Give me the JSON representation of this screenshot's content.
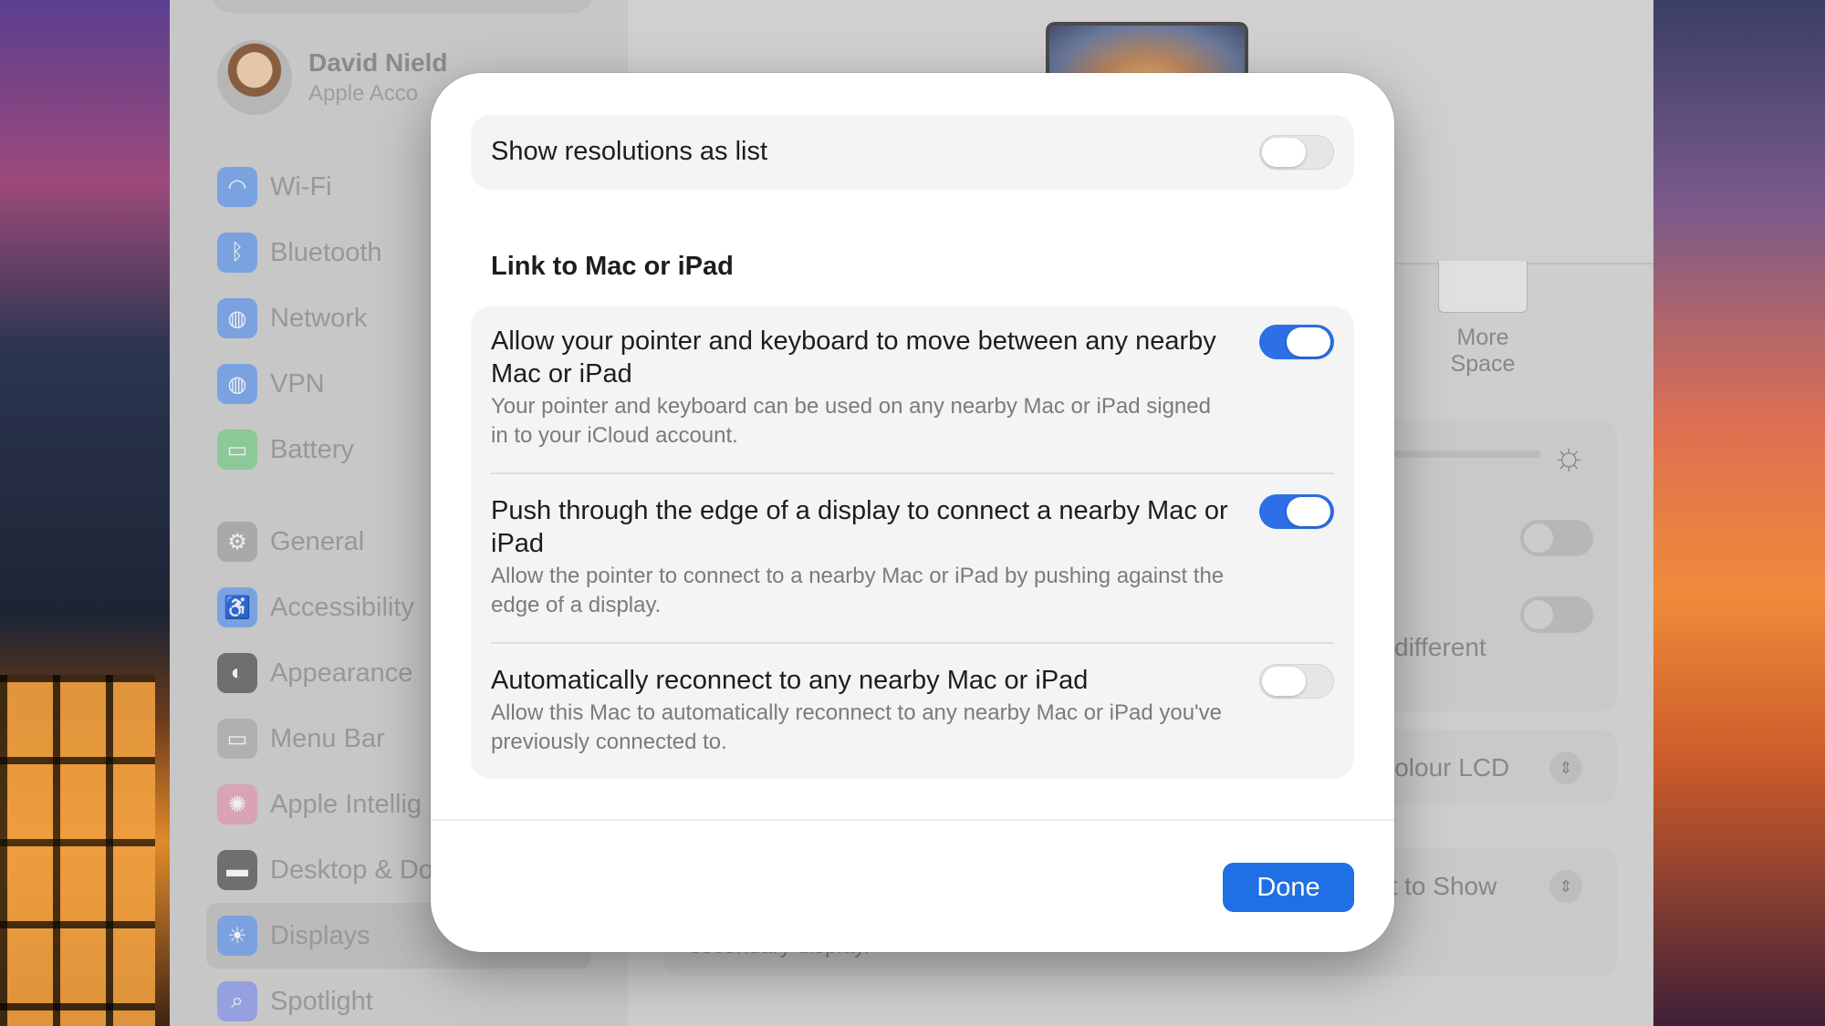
{
  "sidebar": {
    "profile": {
      "name": "David Nield",
      "subtitle": "Apple Acco"
    },
    "items": [
      {
        "label": "Wi-Fi",
        "icon": "wifi-icon",
        "color": "#3a82f7"
      },
      {
        "label": "Bluetooth",
        "icon": "bluetooth-icon",
        "color": "#3a82f7"
      },
      {
        "label": "Network",
        "icon": "globe-icon",
        "color": "#3a82f7"
      },
      {
        "label": "VPN",
        "icon": "vpn-globe-icon",
        "color": "#3a82f7"
      },
      {
        "label": "Battery",
        "icon": "battery-icon",
        "color": "#3cc45a"
      },
      {
        "label": "General",
        "icon": "gear-icon",
        "color": "#8e8e93"
      },
      {
        "label": "Accessibility",
        "icon": "accessibility-icon",
        "color": "#2f7cf6"
      },
      {
        "label": "Appearance",
        "icon": "appearance-icon",
        "color": "#1c1c1e"
      },
      {
        "label": "Menu Bar",
        "icon": "menu-bar-icon",
        "color": "#8e8e93"
      },
      {
        "label": "Apple Intellig",
        "icon": "apple-intelligence-icon",
        "color": "#f07aa0"
      },
      {
        "label": "Desktop & Do",
        "icon": "desktop-dock-icon",
        "color": "#1c1c1e"
      },
      {
        "label": "Displays",
        "icon": "displays-icon",
        "color": "#3a82f7"
      },
      {
        "label": "Spotlight",
        "icon": "spotlight-icon",
        "color": "#6a7ff0"
      }
    ]
  },
  "background": {
    "more_space_label": "More Space",
    "different_fragment": "different",
    "colour_lcd_fragment": "Colour LCD",
    "what_to_show_fragment": "at to Show",
    "secondary_display_fragment": "secondary display."
  },
  "modal": {
    "show_resolutions": {
      "label": "Show resolutions as list",
      "on": false
    },
    "link_section_heading": "Link to Mac or iPad",
    "link_rows": [
      {
        "title": "Allow your pointer and keyboard to move between any nearby Mac or iPad",
        "description": "Your pointer and keyboard can be used on any nearby Mac or iPad signed in to your iCloud account.",
        "on": true
      },
      {
        "title": "Push through the edge of a display to connect a nearby Mac or iPad",
        "description": "Allow the pointer to connect to a nearby Mac or iPad by pushing against the edge of a display.",
        "on": true
      },
      {
        "title": "Automatically reconnect to any nearby Mac or iPad",
        "description": "Allow this Mac to automatically reconnect to any nearby Mac or iPad you've previously connected to.",
        "on": false
      }
    ],
    "done_label": "Done",
    "accent_color": "#1f6fe5"
  }
}
